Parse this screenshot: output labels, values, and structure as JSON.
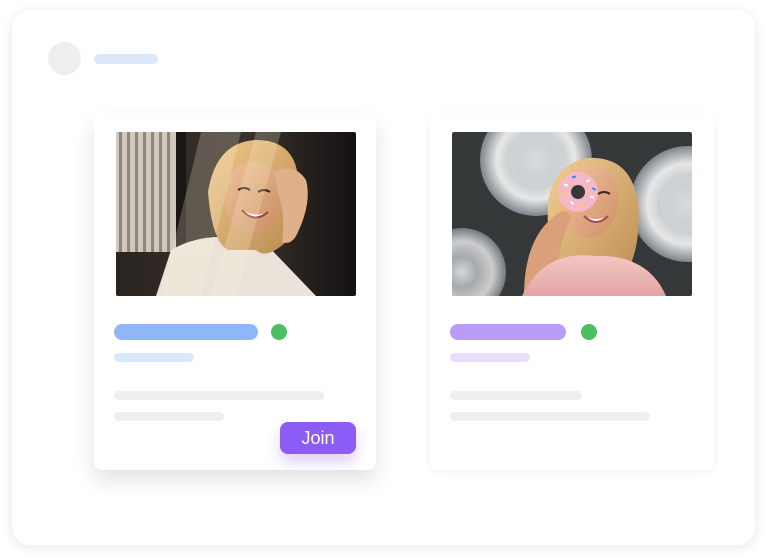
{
  "colors": {
    "frame_bg": "#ffffff",
    "avatar_placeholder": "#eeeeee",
    "header_line": "#dbe8fb",
    "left_title_pill": "#8fb7f7",
    "left_sub_pill": "#dbe8fb",
    "right_title_pill": "#b89cf6",
    "right_sub_pill": "#e8ddfd",
    "status_online": "#4cc061",
    "text_line": "#eeeeee",
    "join_button_bg": "#8b5cf6",
    "join_button_text": "#ffffff"
  },
  "cards": [
    {
      "photo_alt": "",
      "join_label": "Join"
    },
    {
      "photo_alt": ""
    }
  ]
}
